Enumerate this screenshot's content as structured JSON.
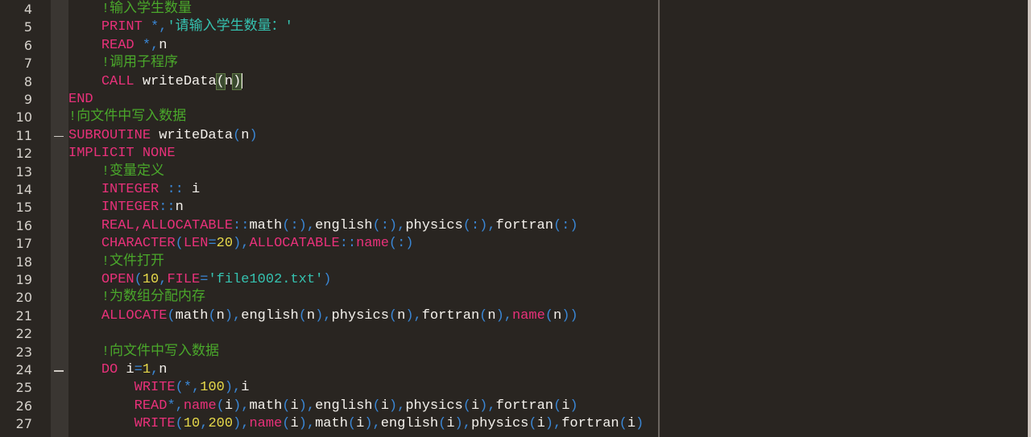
{
  "colors": {
    "background": "#292521",
    "keyword": "#e8317a",
    "comment": "#4aa82b",
    "string": "#35c2b0",
    "number": "#e6d84a",
    "punctuation": "#3a86d4",
    "identifier": "#f4f1ec"
  },
  "editor": {
    "cursor_line": 8,
    "lines": [
      {
        "n": "4",
        "indent": "    ",
        "tokens": [
          [
            "cm",
            "!输入学生数量"
          ]
        ]
      },
      {
        "n": "5",
        "indent": "    ",
        "tokens": [
          [
            "kw",
            "PRINT "
          ],
          [
            "pu",
            "*,"
          ],
          [
            "st",
            "'请输入学生数量：'"
          ]
        ]
      },
      {
        "n": "6",
        "indent": "    ",
        "tokens": [
          [
            "kw",
            "READ "
          ],
          [
            "pu",
            "*,"
          ],
          [
            "id",
            "n"
          ]
        ]
      },
      {
        "n": "7",
        "indent": "    ",
        "tokens": [
          [
            "cm",
            "!调用子程序"
          ]
        ]
      },
      {
        "n": "8",
        "indent": "    ",
        "tokens": [
          [
            "kw",
            "CALL "
          ],
          [
            "id",
            "writeData"
          ],
          [
            "br",
            "("
          ],
          [
            "id",
            "n"
          ],
          [
            "br",
            ")"
          ],
          [
            "cur",
            ""
          ]
        ]
      },
      {
        "n": "9",
        "indent": "",
        "tokens": [
          [
            "kw",
            "END"
          ]
        ]
      },
      {
        "n": "10",
        "indent": "",
        "tokens": [
          [
            "cm",
            "!向文件中写入数据"
          ]
        ]
      },
      {
        "n": "11",
        "indent": "",
        "fold": true,
        "tokens": [
          [
            "kw",
            "SUBROUTINE "
          ],
          [
            "id",
            "writeData"
          ],
          [
            "pu",
            "("
          ],
          [
            "id",
            "n"
          ],
          [
            "pu",
            ")"
          ]
        ]
      },
      {
        "n": "12",
        "indent": "",
        "tokens": [
          [
            "kw",
            "IMPLICIT NONE"
          ]
        ]
      },
      {
        "n": "13",
        "indent": "    ",
        "tokens": [
          [
            "cm",
            "!变量定义"
          ]
        ]
      },
      {
        "n": "14",
        "indent": "    ",
        "tokens": [
          [
            "kw",
            "INTEGER "
          ],
          [
            "pu",
            ":: "
          ],
          [
            "id",
            "i"
          ]
        ]
      },
      {
        "n": "15",
        "indent": "    ",
        "tokens": [
          [
            "kw",
            "INTEGER"
          ],
          [
            "pu",
            "::"
          ],
          [
            "id",
            "n"
          ]
        ]
      },
      {
        "n": "16",
        "indent": "    ",
        "tokens": [
          [
            "kw",
            "REAL,ALLOCATABLE"
          ],
          [
            "pu",
            "::"
          ],
          [
            "id",
            "math"
          ],
          [
            "pu",
            "(:),"
          ],
          [
            "id",
            "english"
          ],
          [
            "pu",
            "(:),"
          ],
          [
            "id",
            "physics"
          ],
          [
            "pu",
            "(:),"
          ],
          [
            "id",
            "fortran"
          ],
          [
            "pu",
            "(:)"
          ]
        ]
      },
      {
        "n": "17",
        "indent": "    ",
        "tokens": [
          [
            "kw",
            "CHARACTER"
          ],
          [
            "pu",
            "("
          ],
          [
            "kw",
            "LEN"
          ],
          [
            "pu",
            "="
          ],
          [
            "nu",
            "20"
          ],
          [
            "pu",
            "),"
          ],
          [
            "kw",
            "ALLOCATABLE"
          ],
          [
            "pu",
            "::"
          ],
          [
            "kw",
            "name"
          ],
          [
            "pu",
            "(:)"
          ]
        ]
      },
      {
        "n": "18",
        "indent": "    ",
        "tokens": [
          [
            "cm",
            "!文件打开"
          ]
        ]
      },
      {
        "n": "19",
        "indent": "    ",
        "tokens": [
          [
            "kw",
            "OPEN"
          ],
          [
            "pu",
            "("
          ],
          [
            "nu",
            "10"
          ],
          [
            "pu",
            ","
          ],
          [
            "kw",
            "FILE"
          ],
          [
            "pu",
            "="
          ],
          [
            "st",
            "'file1002.txt'"
          ],
          [
            "pu",
            ")"
          ]
        ]
      },
      {
        "n": "20",
        "indent": "    ",
        "tokens": [
          [
            "cm",
            "!为数组分配内存"
          ]
        ]
      },
      {
        "n": "21",
        "indent": "    ",
        "tokens": [
          [
            "kw",
            "ALLOCATE"
          ],
          [
            "pu",
            "("
          ],
          [
            "id",
            "math"
          ],
          [
            "pu",
            "("
          ],
          [
            "id",
            "n"
          ],
          [
            "pu",
            "),"
          ],
          [
            "id",
            "english"
          ],
          [
            "pu",
            "("
          ],
          [
            "id",
            "n"
          ],
          [
            "pu",
            "),"
          ],
          [
            "id",
            "physics"
          ],
          [
            "pu",
            "("
          ],
          [
            "id",
            "n"
          ],
          [
            "pu",
            "),"
          ],
          [
            "id",
            "fortran"
          ],
          [
            "pu",
            "("
          ],
          [
            "id",
            "n"
          ],
          [
            "pu",
            "),"
          ],
          [
            "kw",
            "name"
          ],
          [
            "pu",
            "("
          ],
          [
            "id",
            "n"
          ],
          [
            "pu",
            "))"
          ]
        ]
      },
      {
        "n": "22",
        "indent": "",
        "tokens": []
      },
      {
        "n": "23",
        "indent": "    ",
        "tokens": [
          [
            "cm",
            "!向文件中写入数据"
          ]
        ]
      },
      {
        "n": "24",
        "indent": "    ",
        "fold": true,
        "tokens": [
          [
            "kw",
            "DO "
          ],
          [
            "id",
            "i"
          ],
          [
            "pu",
            "="
          ],
          [
            "nu",
            "1"
          ],
          [
            "pu",
            ","
          ],
          [
            "id",
            "n"
          ]
        ]
      },
      {
        "n": "25",
        "indent": "        ",
        "tokens": [
          [
            "kw",
            "WRITE"
          ],
          [
            "pu",
            "(*,"
          ],
          [
            "nu",
            "100"
          ],
          [
            "pu",
            "),"
          ],
          [
            "id",
            "i"
          ]
        ]
      },
      {
        "n": "26",
        "indent": "        ",
        "tokens": [
          [
            "kw",
            "READ"
          ],
          [
            "pu",
            "*,"
          ],
          [
            "kw",
            "name"
          ],
          [
            "pu",
            "("
          ],
          [
            "id",
            "i"
          ],
          [
            "pu",
            "),"
          ],
          [
            "id",
            "math"
          ],
          [
            "pu",
            "("
          ],
          [
            "id",
            "i"
          ],
          [
            "pu",
            "),"
          ],
          [
            "id",
            "english"
          ],
          [
            "pu",
            "("
          ],
          [
            "id",
            "i"
          ],
          [
            "pu",
            "),"
          ],
          [
            "id",
            "physics"
          ],
          [
            "pu",
            "("
          ],
          [
            "id",
            "i"
          ],
          [
            "pu",
            "),"
          ],
          [
            "id",
            "fortran"
          ],
          [
            "pu",
            "("
          ],
          [
            "id",
            "i"
          ],
          [
            "pu",
            ")"
          ]
        ]
      },
      {
        "n": "27",
        "indent": "        ",
        "tokens": [
          [
            "kw",
            "WRITE"
          ],
          [
            "pu",
            "("
          ],
          [
            "nu",
            "10"
          ],
          [
            "pu",
            ","
          ],
          [
            "nu",
            "200"
          ],
          [
            "pu",
            "),"
          ],
          [
            "kw",
            "name"
          ],
          [
            "pu",
            "("
          ],
          [
            "id",
            "i"
          ],
          [
            "pu",
            "),"
          ],
          [
            "id",
            "math"
          ],
          [
            "pu",
            "("
          ],
          [
            "id",
            "i"
          ],
          [
            "pu",
            "),"
          ],
          [
            "id",
            "english"
          ],
          [
            "pu",
            "("
          ],
          [
            "id",
            "i"
          ],
          [
            "pu",
            "),"
          ],
          [
            "id",
            "physics"
          ],
          [
            "pu",
            "("
          ],
          [
            "id",
            "i"
          ],
          [
            "pu",
            "),"
          ],
          [
            "id",
            "fortran"
          ],
          [
            "pu",
            "("
          ],
          [
            "id",
            "i"
          ],
          [
            "pu",
            ")"
          ]
        ]
      }
    ]
  }
}
